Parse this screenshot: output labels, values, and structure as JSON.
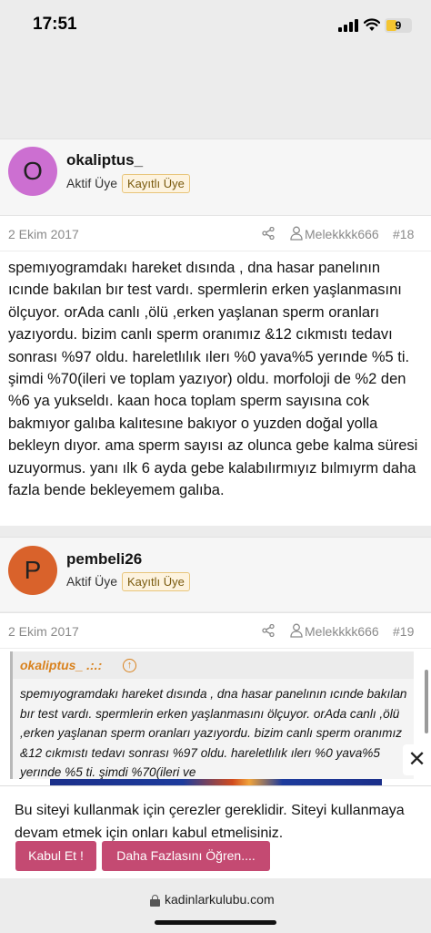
{
  "status_bar": {
    "time": "17:51",
    "battery": "9",
    "colors": {
      "battery_fill": "#f4c531"
    }
  },
  "posts": [
    {
      "avatar_letter": "O",
      "avatar_color": "#cc6fd1",
      "username": "okaliptus_",
      "title": "Aktif Üye",
      "badge": "Kayıtlı Üye",
      "date": "2 Ekim 2017",
      "quoted_user": "Melekkkk666",
      "post_number": "#18",
      "body": "spemıyogramdakı hareket dısında , dna hasar panelının ıcınde bakılan bır test vardı. spermlerin erken yaşlanmasını ölçuyor. orAda canlı ,ölü ,erken yaşlanan sperm oranları yazıyordu. bizim canlı sperm oranımız &12 cıkmıstı tedavı sonrası %97 oldu. hareletlılık ılerı %0 yava%5 yerınde %5 ti. şimdi %70(ileri ve toplam yazıyor) oldu. morfoloji de %2 den %6 ya yukseldı. kaan hoca toplam sperm sayısına cok bakmıyor galıba kalıtesıne bakıyor o yuzden doğal yolla bekleyn dıyor. ama sperm sayısı az olunca gebe kalma süresi uzuyormus. yanı ılk 6 ayda gebe kalabılırmıyız bılmıyrm daha fazla bende bekleyemem galıba."
    },
    {
      "avatar_letter": "P",
      "avatar_color": "#d9622b",
      "username": "pembeli26",
      "title": "Aktif Üye",
      "badge": "Kayıtlı Üye",
      "date": "2 Ekim 2017",
      "quoted_user": "Melekkkk666",
      "post_number": "#19",
      "quote": {
        "author": "okaliptus_ .:.:",
        "text": "spemıyogramdakı hareket dısında , dna hasar panelının ıcınde bakılan bır test vardı. spermlerin erken yaşlanmasını ölçuyor. orAda canlı ,ölü ,erken yaşlanan sperm oranları yazıyordu. bizim canlı sperm oranımız &12 cıkmıstı tedavı sonrası %97 oldu. hareletlılık ılerı %0 yava%5 yerınde %5 ti. şimdi %70(ileri ve"
      }
    }
  ],
  "cookie_banner": {
    "text": "Bu siteyi kullanmak için çerezler gereklidir. Siteyi kullanmaya devam etmek için onları kabul etmelisiniz.",
    "accept_label": "Kabul Et !",
    "more_label": "Daha Fazlasını Öğren....",
    "close_label": "✕",
    "colors": {
      "button": "#c44a72"
    }
  },
  "url_bar": {
    "domain": "kadinlarkulubu.com"
  }
}
